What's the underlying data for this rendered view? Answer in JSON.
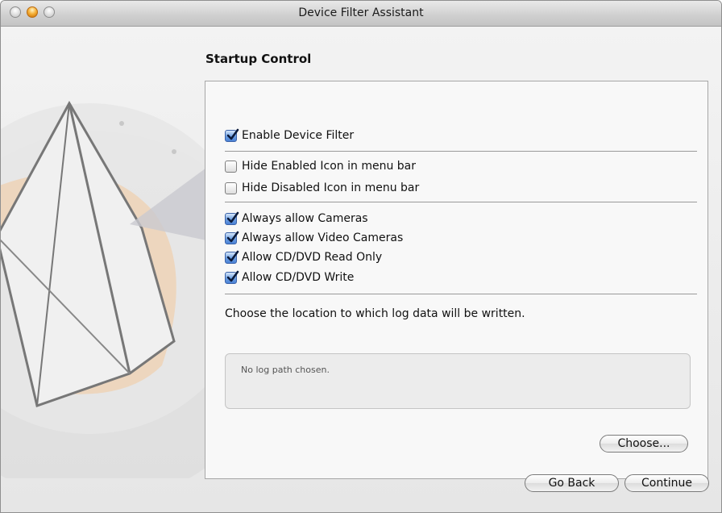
{
  "window": {
    "title": "Device Filter Assistant",
    "traffic_lights": [
      "close",
      "minimize",
      "zoom"
    ]
  },
  "page": {
    "heading": "Startup Control"
  },
  "options": {
    "enable_filter": {
      "label": "Enable Device Filter",
      "checked": true
    },
    "hide_enabled_icon": {
      "label": "Hide Enabled Icon in menu bar",
      "checked": false
    },
    "hide_disabled_icon": {
      "label": "Hide Disabled Icon in menu bar",
      "checked": false
    },
    "allow_cameras": {
      "label": "Always allow Cameras",
      "checked": true
    },
    "allow_video_cameras": {
      "label": "Always allow Video Cameras",
      "checked": true
    },
    "allow_cd_read": {
      "label": "Allow CD/DVD Read Only",
      "checked": true
    },
    "allow_cd_write": {
      "label": "Allow CD/DVD Write",
      "checked": true
    }
  },
  "log": {
    "description": "Choose the location to which log data will be written.",
    "path_text": "No log path chosen.",
    "choose_label": "Choose..."
  },
  "nav": {
    "back_label": "Go Back",
    "continue_label": "Continue"
  },
  "colors": {
    "checkbox_accent": "#4a82d6",
    "minimize_light": "#f6b23a"
  }
}
